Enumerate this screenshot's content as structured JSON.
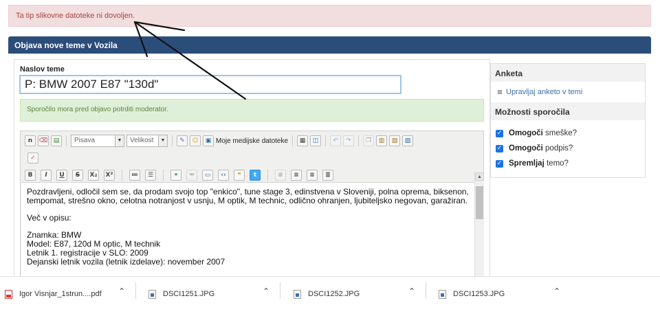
{
  "error_message": "Ta tip slikovne datoteke ni dovoljen.",
  "header": {
    "title": "Objava nove teme v Vozila"
  },
  "form": {
    "title_label": "Naslov teme",
    "title_value": "P: BMW 2007 E87 \"130d\""
  },
  "moderation_notice": "Sporočilo mora pred objavo potrditi moderator.",
  "toolbar": {
    "font_select": "Pisava",
    "size_select": "Velikost",
    "media_label": "Moje medijske datoteke",
    "icons_row1": [
      "source-icon",
      "eraser-icon",
      "template-icon",
      "font-select",
      "size-select",
      "font-color-icon",
      "smiley-icon",
      "media-icon",
      "table-icon",
      "layout-icon",
      "undo-icon",
      "redo-icon",
      "copy-icon",
      "paste-icon",
      "paste-text-icon",
      "paste-word-icon"
    ],
    "icons_row3": [
      "bold-icon",
      "italic-icon",
      "underline-icon",
      "strikethrough-icon",
      "subscript-icon",
      "superscript-icon",
      "numbered-list-icon",
      "bulleted-list-icon",
      "link-icon",
      "unlink-icon",
      "image-icon",
      "code-icon",
      "quote-icon",
      "twitter-icon",
      "align-left-icon",
      "align-center-icon",
      "align-right-icon",
      "justify-icon"
    ]
  },
  "editor": {
    "paragraph1": "Pozdravljeni, odločil sem se, da prodam svojo top \"enkico\", tune stage 3, edinstvena v Sloveniji, polna oprema, biksenon, tempomat, strešno okno, celotna notranjost v usnju, M optik, M technic, odlično ohranjen, ljubiteljsko negovan, garažiran.",
    "paragraph2": "Več v opisu:",
    "line1": "Znamka: BMW",
    "line2": "Model: E87, 120d M optic, M technik",
    "line3": "Letnik 1. registracije v SLO: 2009",
    "line4": "Dejanski letnik vozila (letnik izdelave): november 2007"
  },
  "sidebar": {
    "poll_heading": "Anketa",
    "poll_link": "Upravljaj anketo v temi",
    "options_heading": "Možnosti sporočila",
    "options": [
      {
        "bold": "Omogoči",
        "rest": " smeške?",
        "checked": true
      },
      {
        "bold": "Omogoči",
        "rest": " podpis?",
        "checked": true
      },
      {
        "bold": "Spremljaj",
        "rest": " temo?",
        "checked": true
      }
    ]
  },
  "downloads": [
    {
      "name": "Igor Visnjar_1strun....pdf",
      "type": "pdf"
    },
    {
      "name": "DSCI1251.JPG",
      "type": "jpg"
    },
    {
      "name": "DSCI1252.JPG",
      "type": "jpg"
    },
    {
      "name": "DSCI1253.JPG",
      "type": "jpg"
    }
  ],
  "colors": {
    "header_bg": "#2b4d7a",
    "error_bg": "#f2dede",
    "notice_bg": "#dff0d8",
    "checkbox": "#1a73e8",
    "link": "#3b6fa8"
  }
}
